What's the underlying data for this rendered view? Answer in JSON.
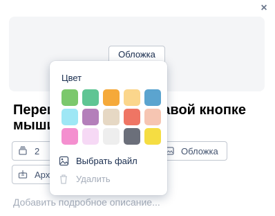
{
  "close_icon": "×",
  "cover": {
    "button_label": "Обложка"
  },
  "card": {
    "title": "Переименовать по правой кнопке мыши",
    "count_chip": "2",
    "cover_chip": "Обложка",
    "archive_chip": "Архив",
    "description_placeholder": "Добавить подробное описание..."
  },
  "popup": {
    "title": "Цвет",
    "colors": [
      "#7bc86c",
      "#5fc594",
      "#f5a93a",
      "#fbd68c",
      "#5ba4cf",
      "#9ee7f5",
      "#b47fba",
      "#e6d8c4",
      "#ef7564",
      "#f6c5b2",
      "#f48fcf",
      "#f6d9f5",
      "#eeeeee",
      "#6b6f7a",
      "#f5dd42"
    ],
    "pick_file_label": "Выбрать файл",
    "delete_label": "Удалить"
  }
}
